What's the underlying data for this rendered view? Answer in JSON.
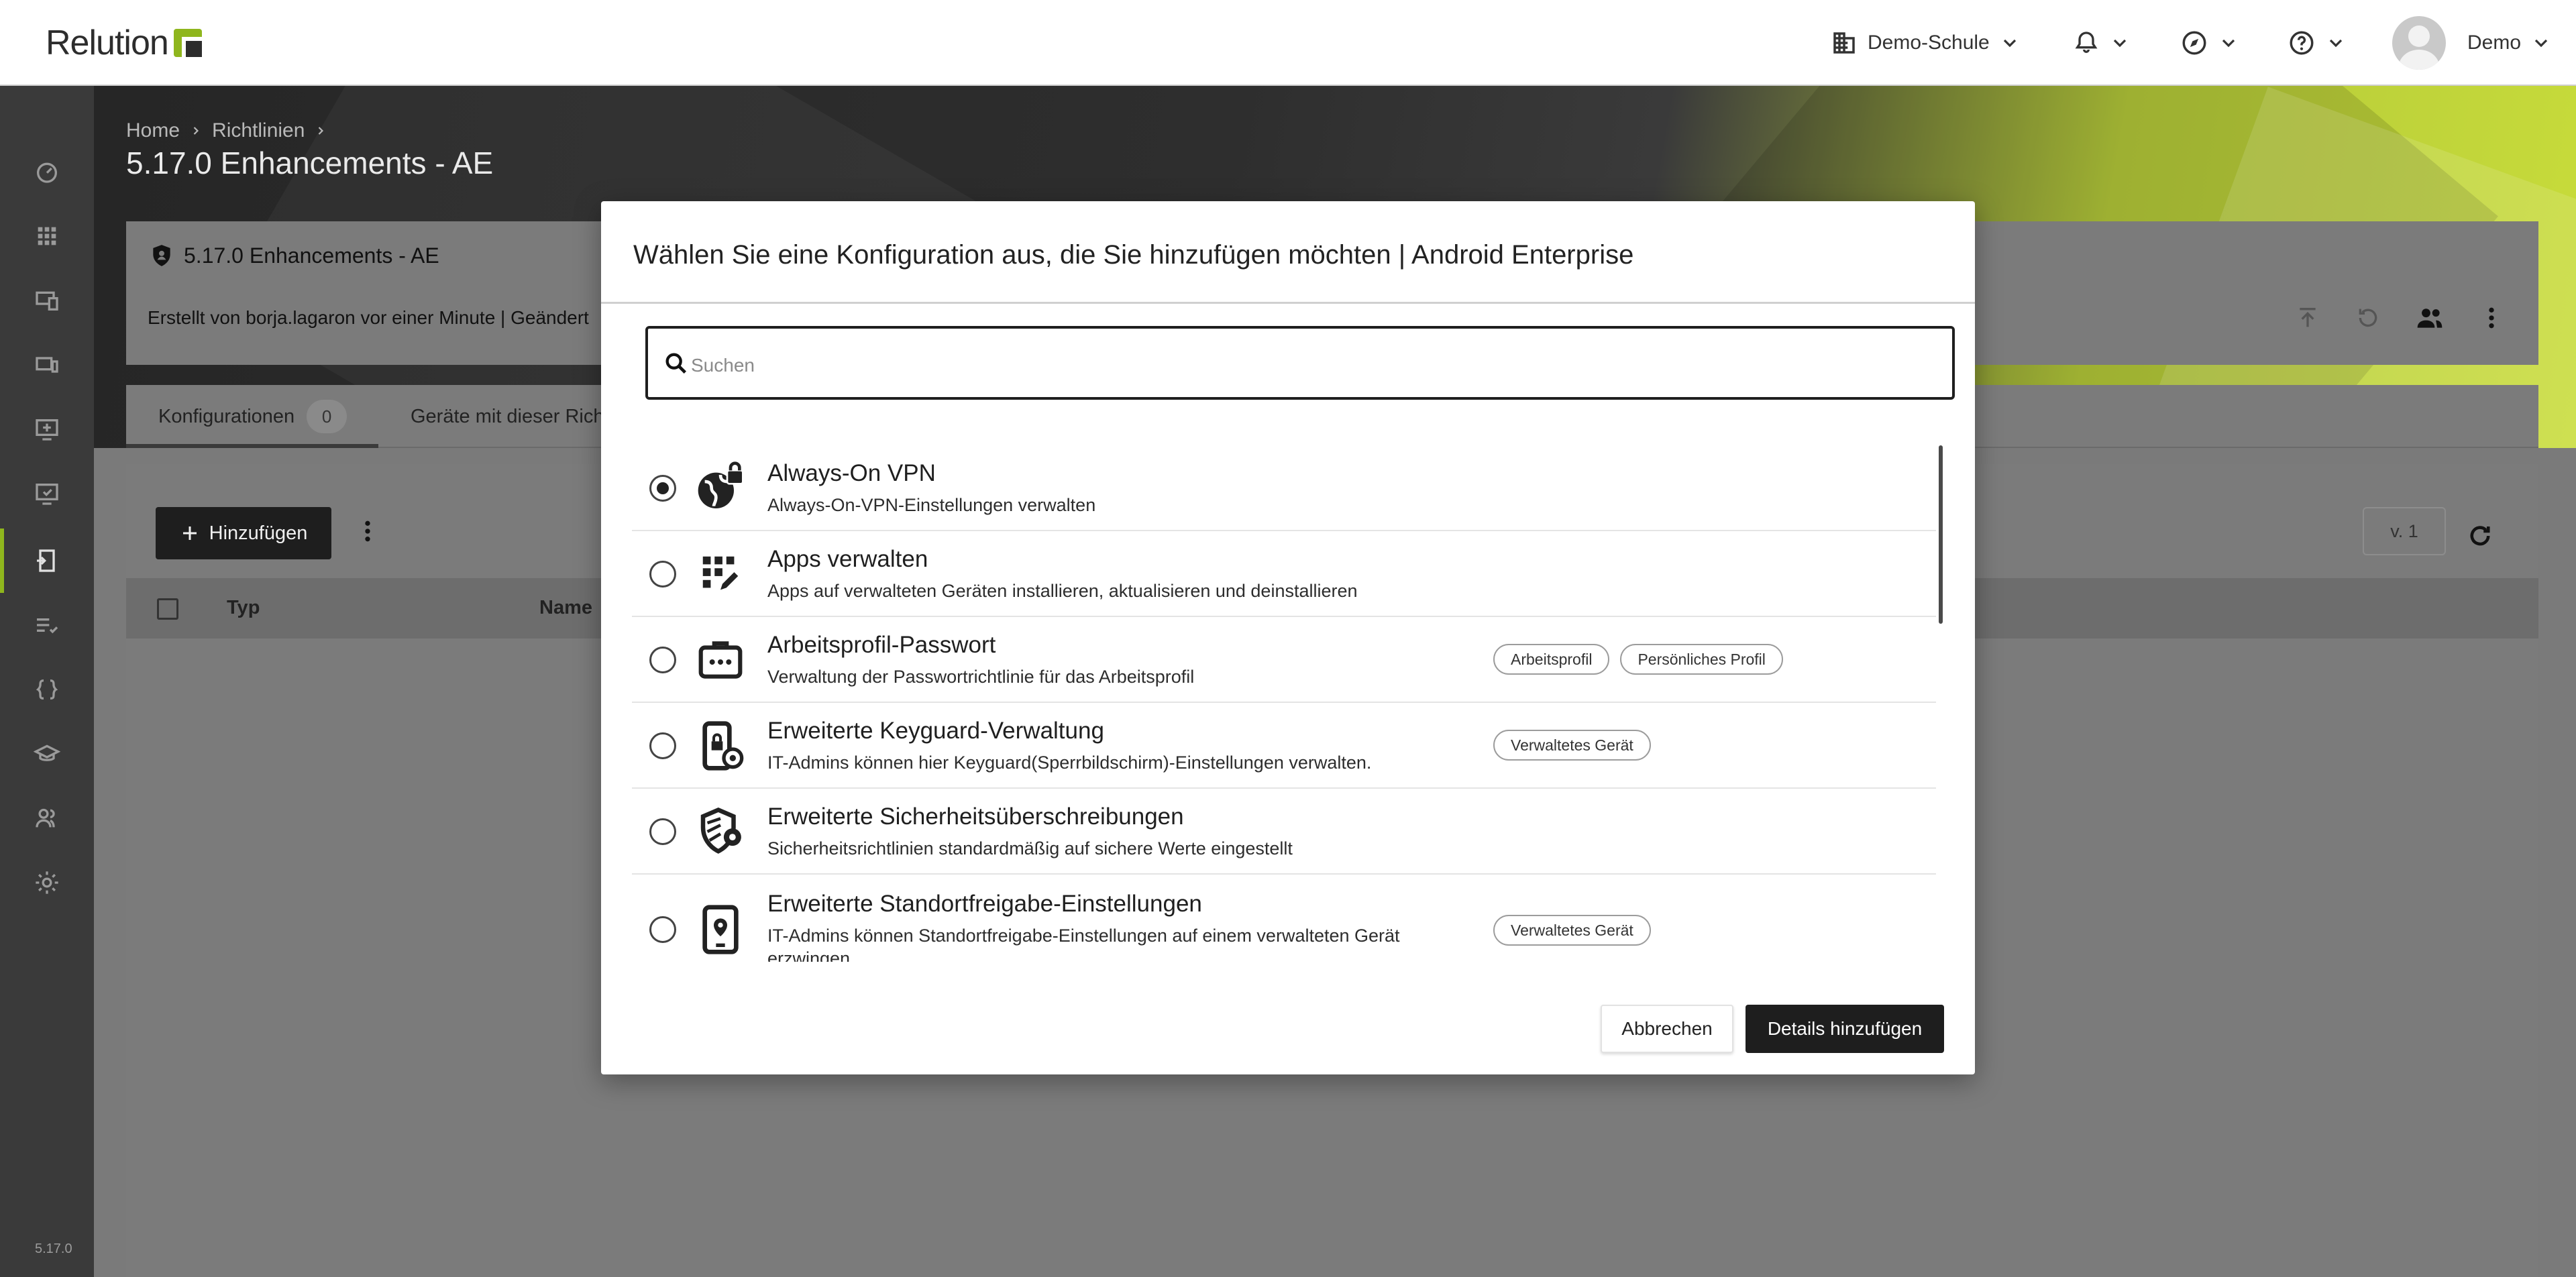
{
  "app": {
    "name": "Relution",
    "version": "5.17.0"
  },
  "topbar": {
    "organization": "Demo-Schule",
    "user": "Demo"
  },
  "breadcrumb": [
    "Home",
    "Richtlinien"
  ],
  "page": {
    "title": "5.17.0 Enhancements - AE"
  },
  "policy": {
    "name": "5.17.0 Enhancements - AE",
    "meta": "Erstellt von borja.lagaron vor einer Minute  |  Geändert"
  },
  "tabs": [
    {
      "label": "Konfigurationen",
      "count": "0"
    },
    {
      "label": "Geräte mit dieser Richt"
    }
  ],
  "content": {
    "add_label": "Hinzufügen",
    "version": "v. 1",
    "columns": [
      "Typ",
      "Name"
    ]
  },
  "modal": {
    "title": "Wählen Sie eine Konfiguration aus, die Sie hinzufügen möchten | Android Enterprise",
    "search_placeholder": "Suchen",
    "items": [
      {
        "title": "Always-On VPN",
        "description": "Always-On-VPN-Einstellungen verwalten",
        "tags": [],
        "selected": true,
        "icon": "globe-lock-icon"
      },
      {
        "title": "Apps verwalten",
        "description": "Apps auf verwalteten Geräten installieren, aktualisieren und deinstallieren",
        "tags": [],
        "selected": false,
        "icon": "apps-edit-icon"
      },
      {
        "title": "Arbeitsprofil-Passwort",
        "description": "Verwaltung der Passwortrichtlinie für das Arbeitsprofil",
        "tags": [
          "Arbeitsprofil",
          "Persönliches Profil"
        ],
        "selected": false,
        "icon": "briefcase-password-icon"
      },
      {
        "title": "Erweiterte Keyguard-Verwaltung",
        "description": "IT-Admins können hier Keyguard(Sperrbildschirm)-Einstellungen verwalten.",
        "tags": [
          "Verwaltetes Gerät"
        ],
        "selected": false,
        "icon": "phone-lock-settings-icon"
      },
      {
        "title": "Erweiterte Sicherheitsüberschreibungen",
        "description": "Sicherheitsrichtlinien standardmäßig auf sichere Werte eingestellt",
        "tags": [],
        "selected": false,
        "icon": "shield-gear-icon"
      },
      {
        "title": "Erweiterte Standortfreigabe-Einstellungen",
        "description": "IT-Admins können Standortfreigabe-Einstellungen auf einem verwalteten Gerät erzwingen.",
        "tags": [
          "Verwaltetes Gerät"
        ],
        "selected": false,
        "icon": "tablet-location-icon"
      }
    ],
    "cancel_label": "Abbrechen",
    "confirm_label": "Details hinzufügen"
  }
}
